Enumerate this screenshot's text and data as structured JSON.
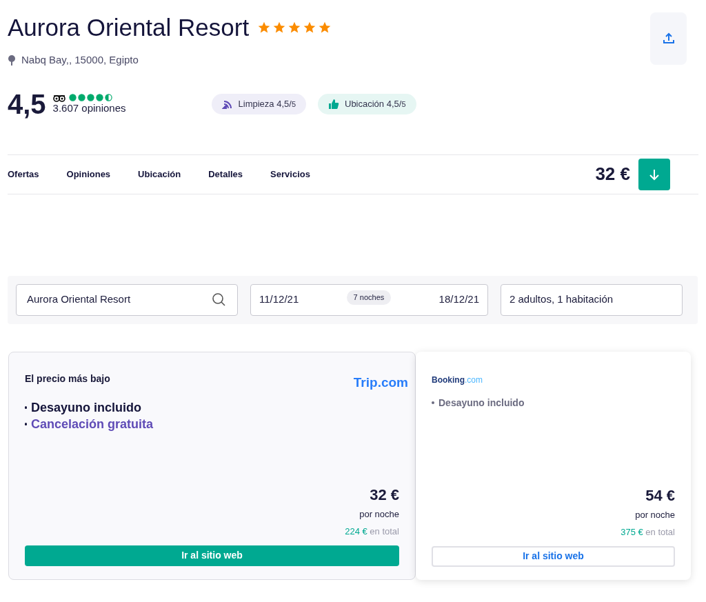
{
  "hotel": {
    "name": "Aurora Oriental Resort",
    "stars": 5,
    "address": "Nabq Bay,, 15000, Egipto"
  },
  "rating": {
    "score": "4,5",
    "stars": 4.5,
    "reviews": "3.607 opiniones"
  },
  "badges": [
    {
      "kind": "cleaning",
      "label": "Limpieza 4,5/",
      "suffix": "5"
    },
    {
      "kind": "location",
      "label": "Ubicación 4,5/",
      "suffix": "5"
    }
  ],
  "tabs": [
    {
      "label": "Ofertas",
      "selected": false
    },
    {
      "label": "Opiniones",
      "selected": false
    },
    {
      "label": "Ubicación",
      "selected": false
    },
    {
      "label": "Detalles",
      "selected": false
    },
    {
      "label": "Servicios",
      "selected": false
    }
  ],
  "nav_price": "32 €",
  "search": {
    "destination": "Aurora Oriental Resort",
    "check_in": "11/12/21",
    "nights": "7 noches",
    "check_out": "18/12/21",
    "guests": "2 adultos, 1 habitación"
  },
  "offers": [
    {
      "kind": "featured",
      "tag": "El precio más bajo",
      "logo": {
        "name": "Trip",
        "domain": ".com"
      },
      "features": [
        {
          "kind": "plain",
          "text": "Desayuno incluido"
        },
        {
          "kind": "highlight",
          "text": "Cancelación gratuita"
        }
      ],
      "price": "32 €",
      "per": "por noche",
      "total": "224 €",
      "total_label": "en total",
      "button": "Ir al sitio web"
    },
    {
      "kind": "regular",
      "logo": {
        "name": "Booking",
        "domain": ".com"
      },
      "features": [
        {
          "kind": "plain",
          "text": "Desayuno incluido"
        }
      ],
      "price": "54 €",
      "per": "por noche",
      "total": "375 €",
      "total_label": "en total",
      "button": "Ir al sitio web"
    }
  ]
}
